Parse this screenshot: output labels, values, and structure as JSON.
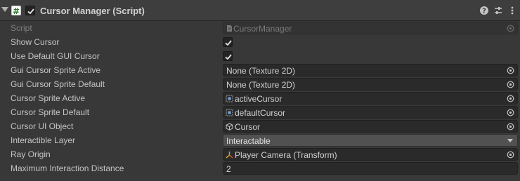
{
  "component": {
    "title": "Cursor Manager (Script)",
    "script_icon_glyph": "#",
    "enabled": true
  },
  "header_icons": [
    "help-icon",
    "preset-icon",
    "more-menu-icon"
  ],
  "properties": {
    "script": {
      "label": "Script",
      "value": "CursorManager"
    },
    "show_cursor": {
      "label": "Show Cursor",
      "checked": true
    },
    "use_default_gui_cursor": {
      "label": "Use Default GUI Cursor",
      "checked": true
    },
    "gui_cursor_sprite_active": {
      "label": "Gui Cursor Sprite Active",
      "value": "None (Texture 2D)"
    },
    "gui_cursor_sprite_default": {
      "label": "Gui Cursor Sprite Default",
      "value": "None (Texture 2D)"
    },
    "cursor_sprite_active": {
      "label": "Cursor Sprite Active",
      "value": "activeCursor"
    },
    "cursor_sprite_default": {
      "label": "Cursor Sprite Default",
      "value": "defaultCursor"
    },
    "cursor_ui_object": {
      "label": "Cursor UI Object",
      "value": "Cursor"
    },
    "interactible_layer": {
      "label": "Interactible Layer",
      "value": "Interactable"
    },
    "ray_origin": {
      "label": "Ray Origin",
      "value": "Player Camera (Transform)"
    },
    "max_interaction_distance": {
      "label": "Maximum Interaction Distance",
      "value": "2"
    }
  },
  "colors": {
    "panel_bg": "#383838",
    "header_bg": "#3e3e3e",
    "field_bg": "#2a2a2a",
    "dropdown_bg": "#515151",
    "text": "#c4c4c4",
    "disabled_text": "#7f7f7f"
  }
}
